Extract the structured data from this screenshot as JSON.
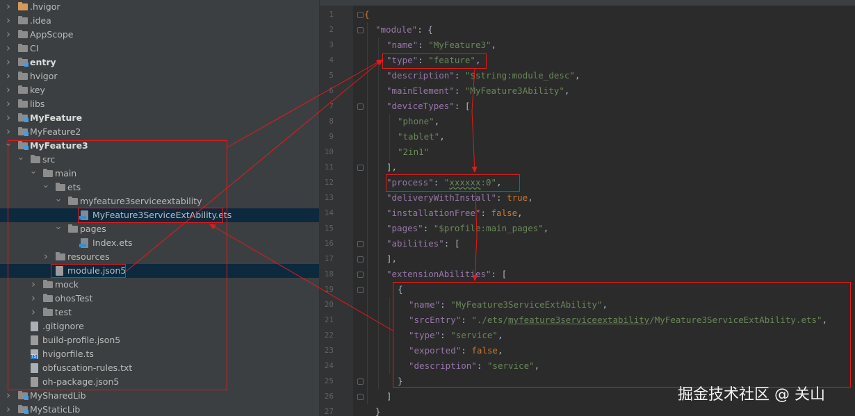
{
  "project_tree": [
    {
      "label": ".hvigor",
      "depth": 0,
      "kind": "folder-orange",
      "expand": "collapsed"
    },
    {
      "label": ".idea",
      "depth": 0,
      "kind": "folder",
      "expand": "collapsed"
    },
    {
      "label": "AppScope",
      "depth": 0,
      "kind": "folder",
      "expand": "collapsed"
    },
    {
      "label": "CI",
      "depth": 0,
      "kind": "folder",
      "expand": "collapsed"
    },
    {
      "label": "entry",
      "depth": 0,
      "kind": "module",
      "expand": "collapsed",
      "bold": true
    },
    {
      "label": "hvigor",
      "depth": 0,
      "kind": "folder",
      "expand": "collapsed"
    },
    {
      "label": "key",
      "depth": 0,
      "kind": "folder",
      "expand": "collapsed"
    },
    {
      "label": "libs",
      "depth": 0,
      "kind": "folder",
      "expand": "collapsed"
    },
    {
      "label": "MyFeature",
      "depth": 0,
      "kind": "module",
      "expand": "collapsed",
      "bold": true
    },
    {
      "label": "MyFeature2",
      "depth": 0,
      "kind": "module",
      "expand": "collapsed"
    },
    {
      "label": "MyFeature3",
      "depth": 0,
      "kind": "module",
      "expand": "expanded",
      "bold": true
    },
    {
      "label": "src",
      "depth": 1,
      "kind": "folder",
      "expand": "expanded"
    },
    {
      "label": "main",
      "depth": 2,
      "kind": "folder",
      "expand": "expanded"
    },
    {
      "label": "ets",
      "depth": 3,
      "kind": "folder",
      "expand": "expanded"
    },
    {
      "label": "myfeature3serviceextability",
      "depth": 4,
      "kind": "folder",
      "expand": "expanded"
    },
    {
      "label": "MyFeature3ServiceExtAbility.ets",
      "depth": 5,
      "kind": "file-ets",
      "expand": "none",
      "selected": true
    },
    {
      "label": "pages",
      "depth": 4,
      "kind": "folder",
      "expand": "expanded"
    },
    {
      "label": "Index.ets",
      "depth": 5,
      "kind": "file-ets",
      "expand": "none"
    },
    {
      "label": "resources",
      "depth": 3,
      "kind": "folder",
      "expand": "collapsed"
    },
    {
      "label": "module.json5",
      "depth": 3,
      "kind": "file-json",
      "expand": "none",
      "selected": true
    },
    {
      "label": "mock",
      "depth": 2,
      "kind": "folder",
      "expand": "collapsed"
    },
    {
      "label": "ohosTest",
      "depth": 2,
      "kind": "folder",
      "expand": "collapsed"
    },
    {
      "label": "test",
      "depth": 2,
      "kind": "folder",
      "expand": "collapsed"
    },
    {
      "label": ".gitignore",
      "depth": 1,
      "kind": "file",
      "expand": "none"
    },
    {
      "label": "build-profile.json5",
      "depth": 1,
      "kind": "file-json",
      "expand": "none"
    },
    {
      "label": "hvigorfile.ts",
      "depth": 1,
      "kind": "file-ts",
      "expand": "none"
    },
    {
      "label": "obfuscation-rules.txt",
      "depth": 1,
      "kind": "file",
      "expand": "none"
    },
    {
      "label": "oh-package.json5",
      "depth": 1,
      "kind": "file-json",
      "expand": "none"
    },
    {
      "label": "MySharedLib",
      "depth": 0,
      "kind": "module",
      "expand": "collapsed"
    },
    {
      "label": "MyStaticLib",
      "depth": 0,
      "kind": "module",
      "expand": "collapsed"
    }
  ],
  "code_lines": [
    {
      "n": "1",
      "indent": 0,
      "tokens": [
        [
          "b",
          "{"
        ]
      ]
    },
    {
      "n": "2",
      "indent": 1,
      "tokens": [
        [
          "k",
          "\"module\""
        ],
        [
          "p",
          ": {"
        ]
      ]
    },
    {
      "n": "3",
      "indent": 2,
      "tokens": [
        [
          "k",
          "\"name\""
        ],
        [
          "p",
          ": "
        ],
        [
          "s",
          "\"MyFeature3\""
        ],
        [
          "p",
          ","
        ]
      ]
    },
    {
      "n": "4",
      "indent": 2,
      "tokens": [
        [
          "k",
          "\"type\""
        ],
        [
          "p",
          ": "
        ],
        [
          "s",
          "\"feature\""
        ],
        [
          "p",
          ","
        ]
      ]
    },
    {
      "n": "5",
      "indent": 2,
      "tokens": [
        [
          "k",
          "\"description\""
        ],
        [
          "p",
          ": "
        ],
        [
          "s",
          "\"$string:module_desc\""
        ],
        [
          "p",
          ","
        ]
      ]
    },
    {
      "n": "6",
      "indent": 2,
      "tokens": [
        [
          "k",
          "\"mainElement\""
        ],
        [
          "p",
          ": "
        ],
        [
          "s",
          "\"MyFeature3Ability\""
        ],
        [
          "p",
          ","
        ]
      ]
    },
    {
      "n": "7",
      "indent": 2,
      "tokens": [
        [
          "k",
          "\"deviceTypes\""
        ],
        [
          "p",
          ": ["
        ]
      ]
    },
    {
      "n": "8",
      "indent": 3,
      "tokens": [
        [
          "s",
          "\"phone\""
        ],
        [
          "p",
          ","
        ]
      ]
    },
    {
      "n": "9",
      "indent": 3,
      "tokens": [
        [
          "s",
          "\"tablet\""
        ],
        [
          "p",
          ","
        ]
      ]
    },
    {
      "n": "10",
      "indent": 3,
      "tokens": [
        [
          "s",
          "\"2in1\""
        ]
      ]
    },
    {
      "n": "11",
      "indent": 2,
      "tokens": [
        [
          "p",
          "],"
        ]
      ]
    },
    {
      "n": "12",
      "indent": 2,
      "tokens": [
        [
          "k",
          "\"process\""
        ],
        [
          "p",
          ": "
        ],
        [
          "s",
          "\""
        ],
        [
          "sw",
          "xxxxxx"
        ],
        [
          "s",
          ":0\""
        ],
        [
          "p",
          ","
        ]
      ]
    },
    {
      "n": "13",
      "indent": 2,
      "tokens": [
        [
          "k",
          "\"deliveryWithInstall\""
        ],
        [
          "p",
          ": "
        ],
        [
          "b",
          "true"
        ],
        [
          "p",
          ","
        ]
      ]
    },
    {
      "n": "14",
      "indent": 2,
      "tokens": [
        [
          "k",
          "\"installationFree\""
        ],
        [
          "p",
          ": "
        ],
        [
          "b",
          "false"
        ],
        [
          "p",
          ","
        ]
      ]
    },
    {
      "n": "15",
      "indent": 2,
      "tokens": [
        [
          "k",
          "\"pages\""
        ],
        [
          "p",
          ": "
        ],
        [
          "s",
          "\"$profile:main_pages\""
        ],
        [
          "p",
          ","
        ]
      ]
    },
    {
      "n": "16",
      "indent": 2,
      "tokens": [
        [
          "k",
          "\"abilities\""
        ],
        [
          "p",
          ": ["
        ]
      ]
    },
    {
      "n": "17",
      "indent": 2,
      "tokens": [
        [
          "p",
          "],"
        ]
      ]
    },
    {
      "n": "18",
      "indent": 2,
      "tokens": [
        [
          "k",
          "\"extensionAbilities\""
        ],
        [
          "p",
          ": ["
        ]
      ]
    },
    {
      "n": "19",
      "indent": 3,
      "tokens": [
        [
          "p",
          "{"
        ]
      ]
    },
    {
      "n": "20",
      "indent": 4,
      "tokens": [
        [
          "k",
          "\"name\""
        ],
        [
          "p",
          ": "
        ],
        [
          "s",
          "\"MyFeature3ServiceExtAbility\""
        ],
        [
          "p",
          ","
        ]
      ]
    },
    {
      "n": "21",
      "indent": 4,
      "tokens": [
        [
          "k",
          "\"srcEntry\""
        ],
        [
          "p",
          ": "
        ],
        [
          "s",
          "\"./ets/"
        ],
        [
          "su",
          "myfeature3serviceextability"
        ],
        [
          "s",
          "/MyFeature3ServiceExtAbility.ets\""
        ],
        [
          "p",
          ","
        ]
      ]
    },
    {
      "n": "22",
      "indent": 4,
      "tokens": [
        [
          "k",
          "\"type\""
        ],
        [
          "p",
          ": "
        ],
        [
          "s",
          "\"service\""
        ],
        [
          "p",
          ","
        ]
      ]
    },
    {
      "n": "23",
      "indent": 4,
      "tokens": [
        [
          "k",
          "\"exported\""
        ],
        [
          "p",
          ": "
        ],
        [
          "b",
          "false"
        ],
        [
          "p",
          ","
        ]
      ]
    },
    {
      "n": "24",
      "indent": 4,
      "tokens": [
        [
          "k",
          "\"description\""
        ],
        [
          "p",
          ": "
        ],
        [
          "s",
          "\"service\""
        ],
        [
          "p",
          ","
        ]
      ]
    },
    {
      "n": "25",
      "indent": 3,
      "tokens": [
        [
          "p",
          "}"
        ]
      ]
    },
    {
      "n": "26",
      "indent": 2,
      "tokens": [
        [
          "p",
          "]"
        ]
      ]
    },
    {
      "n": "27",
      "indent": 1,
      "tokens": [
        [
          "p",
          "}"
        ]
      ]
    }
  ],
  "watermark": "掘金技术社区 @ 关山",
  "colors": {
    "annotation": "#e31b1b",
    "json_key": "#9876aa",
    "json_string": "#6a8759",
    "json_keyword": "#cc7832",
    "selection": "#0d293e"
  },
  "icons": {
    "collapsed": "chevron-right-icon",
    "expanded": "chevron-down-icon",
    "folder": "folder-icon",
    "module": "module-folder-icon",
    "file": "file-icon"
  }
}
